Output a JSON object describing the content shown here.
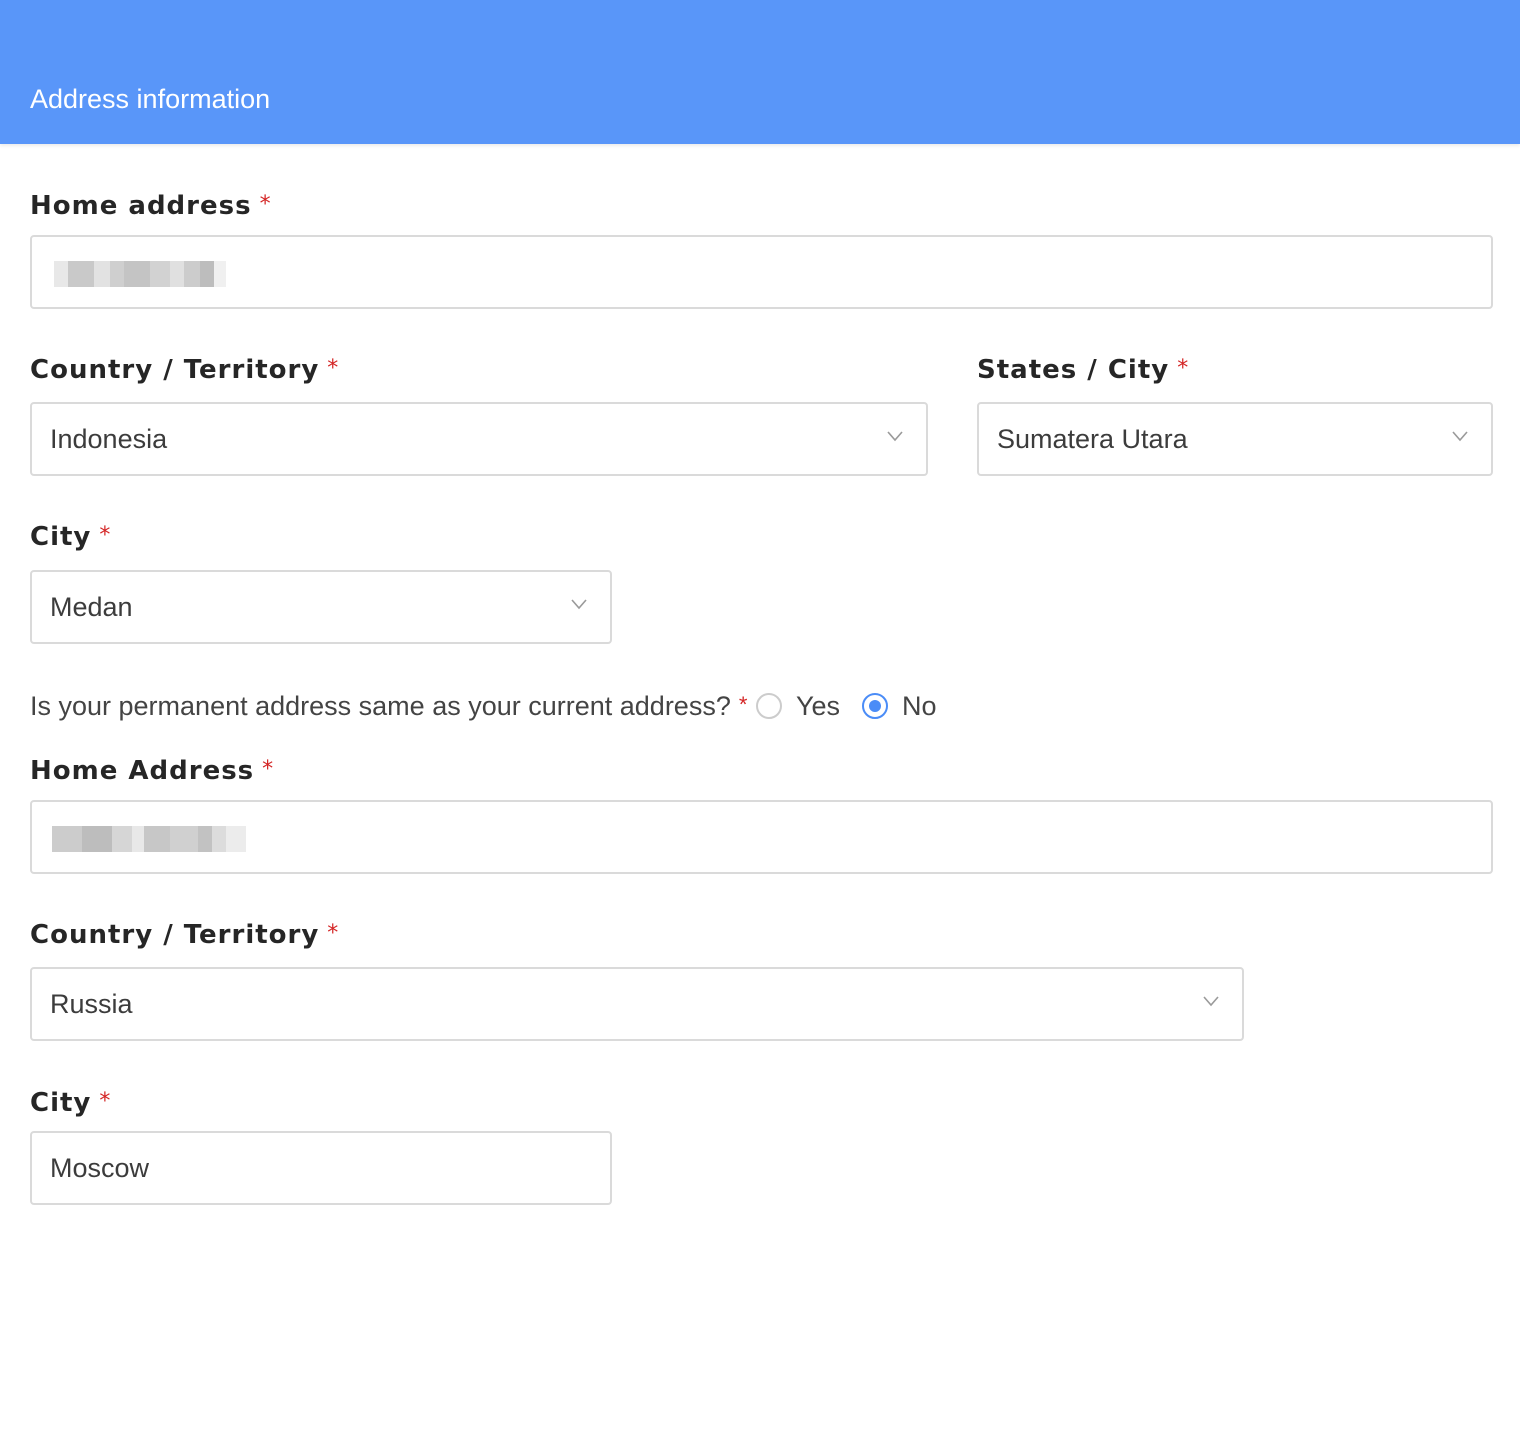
{
  "header": {
    "title": "Address information",
    "color": "#5996f9"
  },
  "current": {
    "home_address_label": "Home address",
    "country_label": "Country / Territory",
    "country_value": "Indonesia",
    "state_label": "States / City",
    "state_value": "Sumatera Utara",
    "city_label": "City",
    "city_value": "Medan"
  },
  "question": {
    "text": "Is your permanent address same as your current address?",
    "options": [
      {
        "label": "Yes",
        "checked": false
      },
      {
        "label": "No",
        "checked": true
      }
    ]
  },
  "permanent": {
    "home_address_label": "Home Address",
    "country_label": "Country / Territory",
    "country_value": "Russia",
    "city_label": "City",
    "city_value": "Moscow"
  },
  "required_marker": "*",
  "icons": {
    "dropdown": "chevron-down-icon",
    "radio": "radio-icon"
  }
}
